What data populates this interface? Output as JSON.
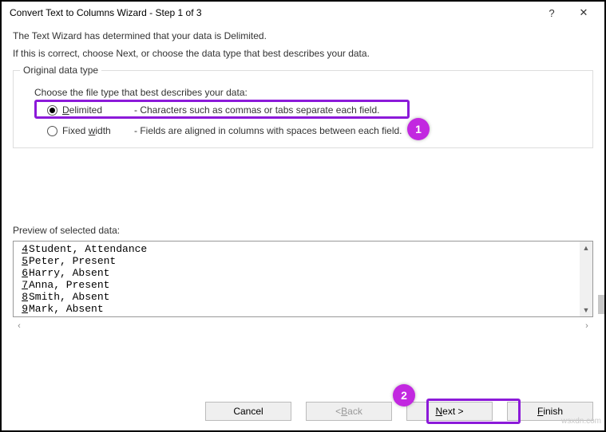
{
  "window": {
    "title": "Convert Text to Columns Wizard - Step 1 of 3"
  },
  "intro": {
    "line1": "The Text Wizard has determined that your data is Delimited.",
    "line2": "If this is correct, choose Next, or choose the data type that best describes your data."
  },
  "group": {
    "legend": "Original data type",
    "choose": "Choose the file type that best describes your data:",
    "option1": {
      "label": "Delimited",
      "desc": "- Characters such as commas or tabs separate each field."
    },
    "option2": {
      "label": "Fixed width",
      "desc": "- Fields are aligned in columns with spaces between each field."
    }
  },
  "preview": {
    "label": "Preview of selected data:",
    "rows": [
      {
        "n": "4",
        "text": "Student, Attendance"
      },
      {
        "n": "5",
        "text": "Peter, Present"
      },
      {
        "n": "6",
        "text": "Harry, Absent"
      },
      {
        "n": "7",
        "text": "Anna, Present"
      },
      {
        "n": "8",
        "text": "Smith, Absent"
      },
      {
        "n": "9",
        "text": "Mark, Absent"
      }
    ]
  },
  "buttons": {
    "cancel": "Cancel",
    "back": "< Back",
    "next": "Next >",
    "finish": "Finish"
  },
  "callouts": {
    "c1": "1",
    "c2": "2"
  },
  "watermark": "wsxdn.com"
}
